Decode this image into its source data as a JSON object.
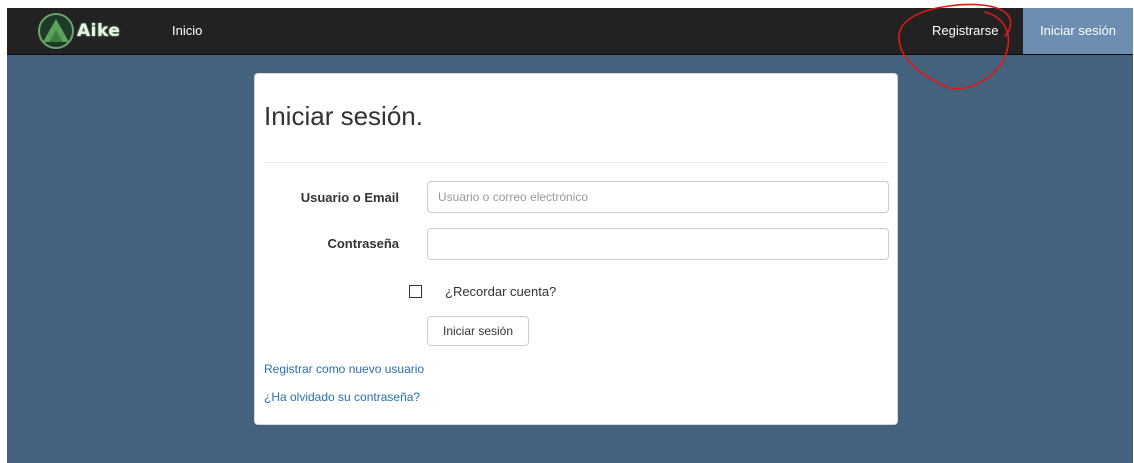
{
  "navbar": {
    "brand_name": "Aike",
    "brand_icon": "green-triangle-logo-icon",
    "home_link": "Inicio",
    "register_link": "Registrarse",
    "login_link": "Iniciar sesión",
    "active_item": "Iniciar sesión",
    "annotation": "red-hand-drawn-circle-around-register-link"
  },
  "login": {
    "title": "Iniciar sesión.",
    "username_label": "Usuario o Email",
    "username_placeholder": "Usuario o correo electrónico",
    "username_value": "",
    "password_label": "Contraseña",
    "password_value": "",
    "remember_label": "¿Recordar cuenta?",
    "remember_checked": false,
    "submit_label": "Iniciar sesión",
    "register_link": "Registrar como nuevo usuario",
    "forgot_link": "¿Ha olvidado su contraseña?"
  },
  "colors": {
    "navbar_bg": "#222222",
    "page_bg": "#44627d",
    "active_nav_bg": "#6c8fb1",
    "link": "#2a6fb0",
    "annotation": "#e01818"
  }
}
